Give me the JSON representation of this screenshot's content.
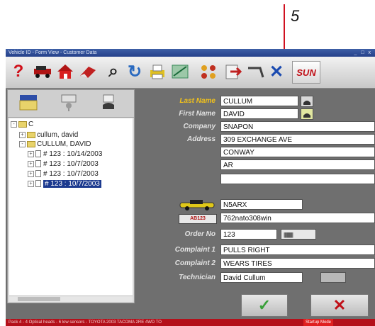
{
  "callout": {
    "number": "5"
  },
  "window": {
    "title": "Vehicle ID - Form View - Customer Data",
    "controls": "_ □ x"
  },
  "toolbar": {
    "items": [
      {
        "name": "help",
        "glyph": "?",
        "color": "#d0101a"
      },
      {
        "name": "vehicle",
        "color": "#2a7a2a"
      },
      {
        "name": "home",
        "color": "#b01414"
      },
      {
        "name": "eraser",
        "color": "#c02020"
      },
      {
        "name": "search",
        "glyph": "⌕",
        "color": "#222222"
      },
      {
        "name": "refresh",
        "glyph": "↻",
        "color": "#2a6ac0"
      },
      {
        "name": "print",
        "color": "#e0c020"
      },
      {
        "name": "measure",
        "color": "#3a8a5a"
      },
      {
        "name": "grid",
        "color": "#c03020"
      },
      {
        "name": "export",
        "color": "#c02020"
      },
      {
        "name": "tool",
        "color": "#404040"
      },
      {
        "name": "close",
        "glyph": "✕",
        "color": "#1a4ab0"
      }
    ],
    "logo": "SUN"
  },
  "tree": {
    "root": "C",
    "items": [
      {
        "label": "cullum, david"
      },
      {
        "label": "CULLUM, DAVID"
      }
    ],
    "records": [
      "# 123 : 10/14/2003",
      "# 123 : 10/7/2003",
      "# 123 : 10/7/2003",
      "# 123 : 10/7/2003"
    ]
  },
  "form": {
    "labels": {
      "last_name": "Last Name",
      "first_name": "First Name",
      "company": "Company",
      "address": "Address",
      "order_no": "Order No",
      "complaint1": "Complaint 1",
      "complaint2": "Complaint 2",
      "technician": "Technician"
    },
    "values": {
      "last_name": "CULLUM",
      "first_name": "DAVID",
      "company": "SNAPON",
      "address1": "309 EXCHANGE AVE",
      "address2": "CONWAY",
      "address3": "AR",
      "address4": "",
      "vehicle": "N5ARX",
      "plate": "762nato308win",
      "order_no": "123",
      "complaint1": "PULLS RIGHT",
      "complaint2": "WEARS TIRES",
      "technician": "David Cullum"
    },
    "plate_icon_text": "AB123",
    "barcode_text": "||||||||||||"
  },
  "buttons": {
    "ok": "✓",
    "cancel": "✕"
  },
  "status": {
    "text": "Pack 4 - 4 Optical heads - 6 low sensors - TOYOTA 2003 TACOMA 2RE 4WD TO",
    "mode": "Startup Mode"
  },
  "colors": {
    "accent_red": "#b4101a",
    "label_yellow": "#f2c21a",
    "selection": "#1c3a8f"
  }
}
